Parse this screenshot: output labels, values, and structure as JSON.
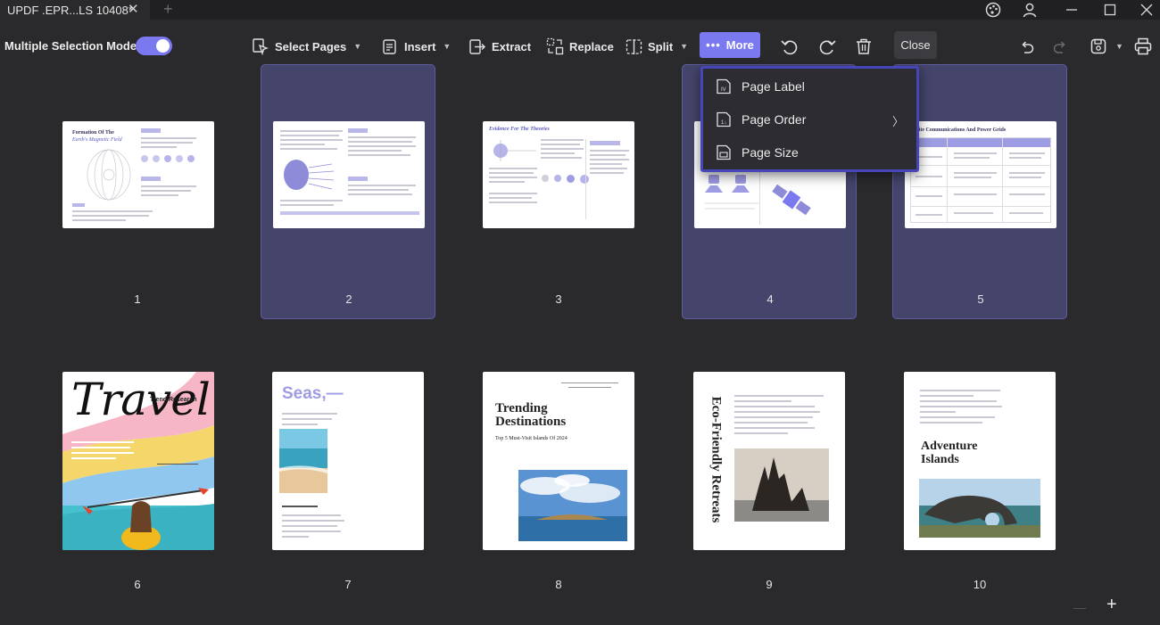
{
  "window": {
    "tab_title": "UPDF .EPR...LS 10408*",
    "tab_close": "✕",
    "tab_add": "+"
  },
  "toolbar": {
    "multiple_selection_label": "Multiple Selection Mode",
    "select_pages_label": "Select Pages",
    "insert_label": "Insert",
    "extract_label": "Extract",
    "replace_label": "Replace",
    "split_label": "Split",
    "more_label": "More",
    "close_label": "Close"
  },
  "dropdown": {
    "items": [
      {
        "label": "Page Label",
        "icon": "page-label-icon"
      },
      {
        "label": "Page Order",
        "icon": "page-order-icon"
      },
      {
        "label": "Page Size",
        "icon": "page-size-icon"
      }
    ]
  },
  "pages": [
    {
      "number": "1",
      "selected": false,
      "title": "Formation Of The",
      "subtitle": "Earth's Magnetic Field"
    },
    {
      "number": "2",
      "selected": true
    },
    {
      "number": "3",
      "selected": false,
      "title": "Evidence For The Theories"
    },
    {
      "number": "4",
      "selected": true
    },
    {
      "number": "5",
      "selected": true,
      "title": "lite Communications And Power Grids"
    },
    {
      "number": "6",
      "selected": false,
      "title": "Travel",
      "subtitle": "Trend Research"
    },
    {
      "number": "7",
      "selected": false,
      "title": "Seas,—"
    },
    {
      "number": "8",
      "selected": false,
      "title": "Trending",
      "title2": "Destinations",
      "subtitle": "Top 5 Must-Visit Islands Of 2024"
    },
    {
      "number": "9",
      "selected": false,
      "title": "Eco-Friendly Retreats"
    },
    {
      "number": "10",
      "selected": false,
      "title": "Adventure",
      "title2": "Islands"
    }
  ],
  "colors": {
    "accent": "#7b79f0",
    "selected_card": "#45446b",
    "dropdown_border": "#4646b8",
    "background": "#2a2a2d"
  },
  "zoom": {
    "minus": "—",
    "plus": "+"
  }
}
